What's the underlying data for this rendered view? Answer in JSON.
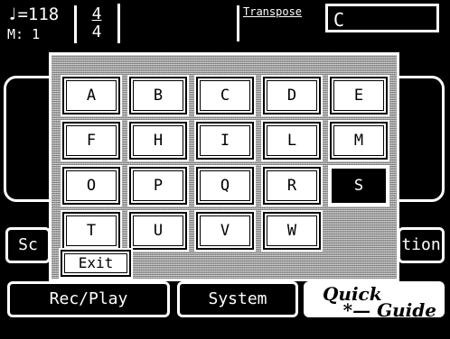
{
  "status_bar": {
    "tempo": "♩=118",
    "measure": "M:   1",
    "beat_numerator": "4",
    "beat_denominator": "4",
    "transpose_label": "Transpose",
    "key_value": "C"
  },
  "background_buttons": {
    "left_partial": "Sc",
    "right_partial": "tion",
    "rec_play": "Rec/Play",
    "system": "System",
    "quick_guide_line1": "Quick",
    "quick_guide_line2": "*— Guide"
  },
  "dialog": {
    "keys": [
      "A",
      "B",
      "C",
      "D",
      "E",
      "F",
      "H",
      "I",
      "L",
      "M",
      "O",
      "P",
      "Q",
      "R",
      "S",
      "T",
      "U",
      "V",
      "W"
    ],
    "selected_key": "S",
    "exit_label": "Exit"
  }
}
